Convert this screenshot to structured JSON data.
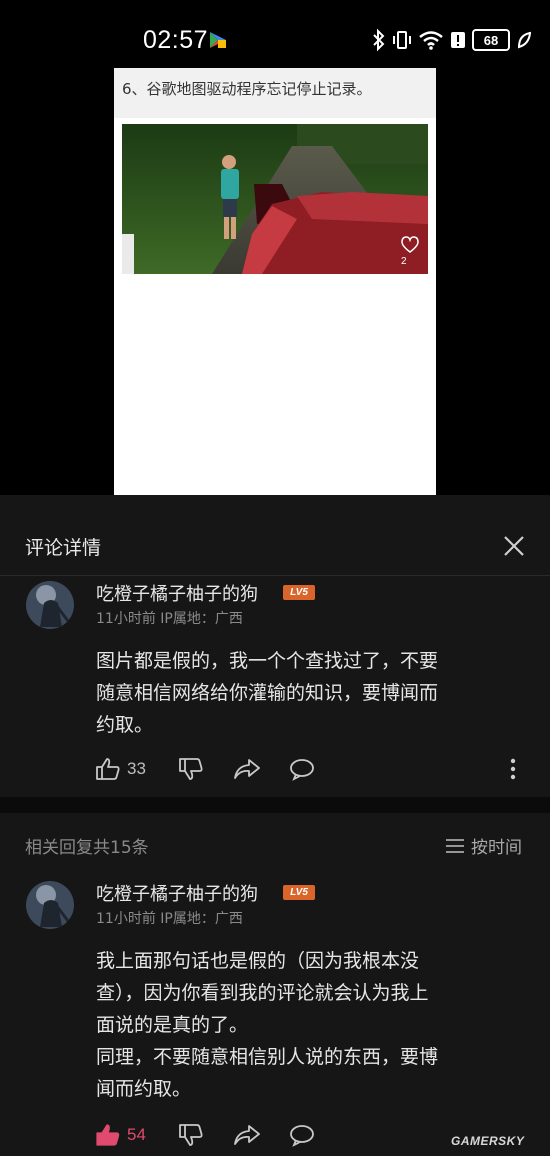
{
  "status_bar": {
    "time": "02:57",
    "battery": "68"
  },
  "preview": {
    "caption": "6、谷歌地图驱动程序忘记停止记录。",
    "photo_like_count": "2"
  },
  "sheet": {
    "title": "评论详情",
    "main_comment": {
      "username": "吃橙子橘子柚子的狗",
      "level": "LV5",
      "meta": "11小时前  IP属地：广西",
      "text": "图片都是假的，我一个个查找过了，不要\n随意相信网络给你灌输的知识，要博闻而\n约取。",
      "likes": "33"
    },
    "replies_header": {
      "count_label": "相关回复共15条",
      "sort_label": "按时间"
    },
    "reply": {
      "username": "吃橙子橘子柚子的狗",
      "level": "LV5",
      "meta": "11小时前  IP属地：广西",
      "text": "我上面那句话也是假的（因为我根本没\n查），因为你看到我的评论就会认为我上\n面说的是真的了。\n同理，不要随意相信别人说的东西，要博\n闻而约取。",
      "likes": "54"
    }
  },
  "watermark": "GAMERSKY",
  "colors": {
    "sheet_bg": "#161616",
    "level_badge": "#d9652b",
    "liked_icon": "#e04a6e"
  }
}
